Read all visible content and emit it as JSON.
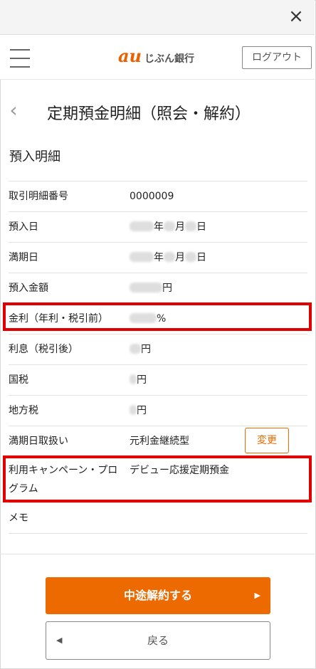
{
  "window": {
    "close_icon": "×"
  },
  "header": {
    "logo_mark": "au",
    "logo_text": "じぶん銀行",
    "logout_label": "ログアウト"
  },
  "page": {
    "back_icon": "‹",
    "title": "定期預金明細（照会・解約）",
    "section_title": "預入明細"
  },
  "details": {
    "serial_label": "取引明細番号",
    "serial_value": "0000009",
    "deposit_date_label": "預入日",
    "year_suffix": "年",
    "month_suffix": "月",
    "day_suffix": "日",
    "maturity_date_label": "満期日",
    "amount_label": "預入金額",
    "yen_suffix": "円",
    "rate_label": "金利（年利・税引前）",
    "percent_suffix": "%",
    "interest_label": "利息（税引後）",
    "national_tax_label": "国税",
    "local_tax_label": "地方税",
    "maturity_handling_label": "満期日取扱い",
    "maturity_handling_value": "元利金継続型",
    "change_button": "変更",
    "campaign_label": "利用キャンペーン・プログラム",
    "campaign_value": "デビュー応援定期預金",
    "memo_label": "メモ"
  },
  "actions": {
    "cancel_label": "中途解約する",
    "back_label": "戻る",
    "right_arrow": "▶",
    "left_arrow": "◀"
  },
  "colors": {
    "accent": "#ec6a00",
    "highlight": "#e00000"
  }
}
